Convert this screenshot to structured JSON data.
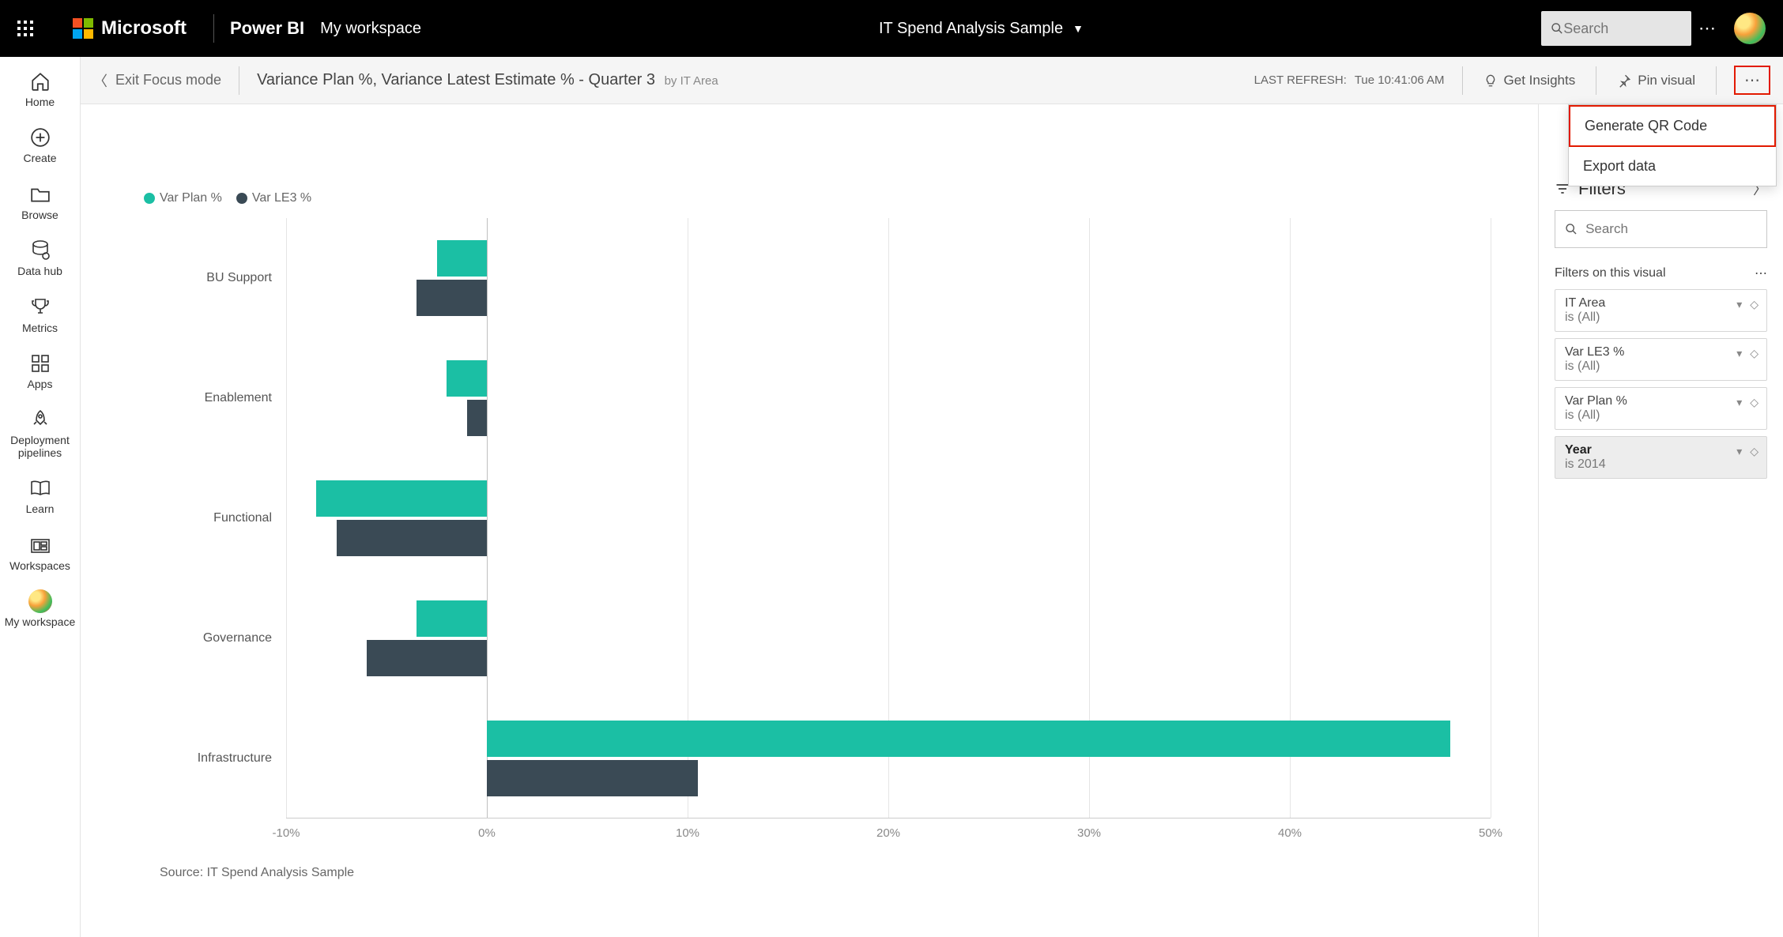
{
  "header": {
    "microsoft": "Microsoft",
    "powerbi": "Power BI",
    "workspace": "My workspace",
    "report_title": "IT Spend Analysis Sample",
    "search_placeholder": "Search"
  },
  "rail": [
    {
      "label": "Home",
      "icon": "home"
    },
    {
      "label": "Create",
      "icon": "plus-circle"
    },
    {
      "label": "Browse",
      "icon": "folder"
    },
    {
      "label": "Data hub",
      "icon": "database"
    },
    {
      "label": "Metrics",
      "icon": "trophy"
    },
    {
      "label": "Apps",
      "icon": "apps"
    },
    {
      "label": "Deployment\npipelines",
      "icon": "rocket"
    },
    {
      "label": "Learn",
      "icon": "book"
    },
    {
      "label": "Workspaces",
      "icon": "grid"
    },
    {
      "label": "My workspace",
      "icon": "avatar"
    }
  ],
  "subheader": {
    "exit": "Exit Focus mode",
    "title_main": "Variance Plan %, Variance Latest Estimate % - Quarter 3",
    "title_by": "by IT Area",
    "last_refresh_label": "LAST REFRESH:",
    "last_refresh_value": "Tue 10:41:06 AM",
    "get_insights": "Get Insights",
    "pin_visual": "Pin visual"
  },
  "dropdown": {
    "generate_qr": "Generate QR Code",
    "export_data": "Export data"
  },
  "legend": {
    "series1": "Var Plan %",
    "series2": "Var LE3 %"
  },
  "source_label": "Source: IT Spend Analysis Sample",
  "filters_panel": {
    "header": "Filters",
    "search_placeholder": "Search",
    "section": "Filters on this visual",
    "cards": [
      {
        "name": "IT Area",
        "value": "is (All)",
        "active": false
      },
      {
        "name": "Var LE3 %",
        "value": "is (All)",
        "active": false
      },
      {
        "name": "Var Plan %",
        "value": "is (All)",
        "active": false
      },
      {
        "name": "Year",
        "value": "is 2014",
        "active": true
      }
    ]
  },
  "chart_data": {
    "type": "bar",
    "orientation": "horizontal",
    "title": "Variance Plan %, Variance Latest Estimate % - Quarter 3 by IT Area",
    "xlabel": "",
    "ylabel": "IT Area",
    "xlim": [
      -10,
      50
    ],
    "x_ticks": [
      -10,
      0,
      10,
      20,
      30,
      40,
      50
    ],
    "x_tick_labels": [
      "-10%",
      "0%",
      "10%",
      "20%",
      "30%",
      "40%",
      "50%"
    ],
    "categories": [
      "BU Support",
      "Enablement",
      "Functional",
      "Governance",
      "Infrastructure"
    ],
    "series": [
      {
        "name": "Var Plan %",
        "color": "#1bbfa4",
        "values": [
          -2.5,
          -2.0,
          -8.5,
          -3.5,
          48.0
        ]
      },
      {
        "name": "Var LE3 %",
        "color": "#3a4a55",
        "values": [
          -3.5,
          -1.0,
          -7.5,
          -6.0,
          10.5
        ]
      }
    ],
    "source": "IT Spend Analysis Sample"
  }
}
